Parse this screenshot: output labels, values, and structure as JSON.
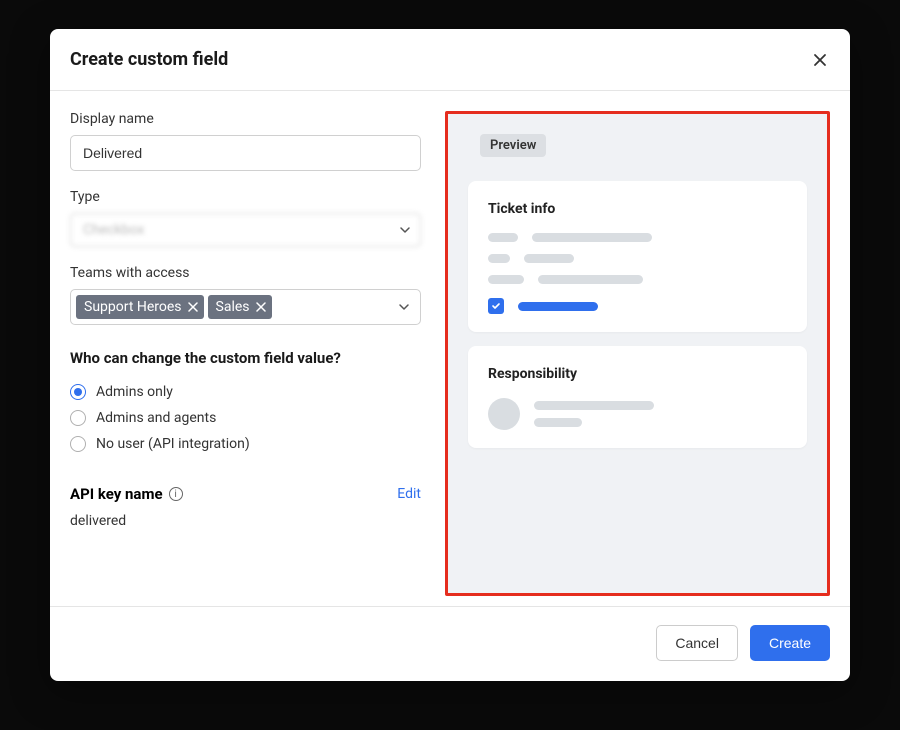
{
  "modal": {
    "title": "Create custom field"
  },
  "form": {
    "display_name_label": "Display name",
    "display_name_value": "Delivered",
    "type_label": "Type",
    "type_value": "Checkbox",
    "teams_label": "Teams with access",
    "teams": [
      "Support Heroes",
      "Sales"
    ],
    "permission_question": "Who can change the custom field value?",
    "permission_options": [
      "Admins only",
      "Admins and agents",
      "No user (API integration)"
    ],
    "permission_selected_index": 0,
    "api_key_label": "API key name",
    "api_key_value": "delivered",
    "edit_label": "Edit"
  },
  "preview": {
    "badge": "Preview",
    "card1_title": "Ticket info",
    "card2_title": "Responsibility"
  },
  "footer": {
    "cancel": "Cancel",
    "create": "Create"
  }
}
